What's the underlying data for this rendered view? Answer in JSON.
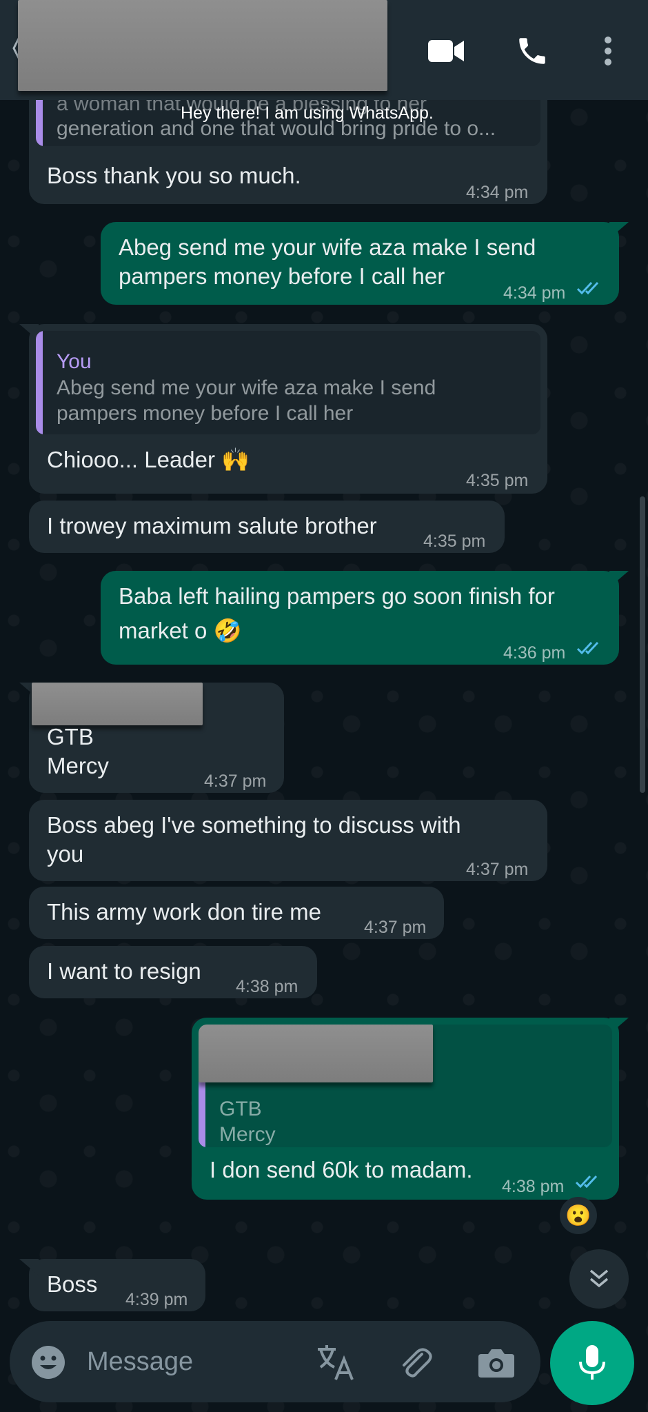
{
  "header": {
    "status": "Hey there! I am using WhatsApp.",
    "icons": [
      "video-call-icon",
      "voice-call-icon",
      "more-options-icon"
    ]
  },
  "messages": [
    {
      "dir": "in",
      "quote_text": [
        "a woman that would be a blessing to her",
        "generation and one that would bring pride to o..."
      ],
      "text": "Boss thank you so much.",
      "time": "4:34 pm"
    },
    {
      "dir": "out",
      "text": [
        "Abeg send me your wife aza make I send",
        "pampers money before I call her"
      ],
      "time": "4:34 pm",
      "status": "read"
    },
    {
      "dir": "in",
      "quote_name": "You",
      "quote_text": [
        "Abeg send me your wife aza make I send",
        "pampers money before I call her"
      ],
      "text": "Chiooo... Leader",
      "emoji": "🙌",
      "time": "4:35 pm"
    },
    {
      "dir": "in",
      "text": "I trowey maximum salute brother",
      "time": "4:35 pm"
    },
    {
      "dir": "out",
      "text": [
        "Baba left hailing pampers go soon finish for",
        "market o"
      ],
      "emoji": "🤣",
      "time": "4:36 pm",
      "status": "read"
    },
    {
      "dir": "in",
      "text": [
        "GTB",
        "Mercy"
      ],
      "time": "4:37 pm"
    },
    {
      "dir": "in",
      "text": [
        "Boss abeg I've something to discuss with",
        "you"
      ],
      "time": "4:37 pm"
    },
    {
      "dir": "in",
      "text": "This army work don tire me",
      "time": "4:37 pm"
    },
    {
      "dir": "in",
      "text": "I want to resign",
      "time": "4:38 pm"
    },
    {
      "dir": "out",
      "quote_text": [
        "GTB",
        "Mercy"
      ],
      "text": "I don send 60k to madam.",
      "time": "4:38 pm",
      "status": "read",
      "reaction": "😮"
    },
    {
      "dir": "in",
      "text": "Boss",
      "time": "4:39 pm"
    }
  ],
  "input": {
    "placeholder": "Message"
  },
  "colors": {
    "incoming": "#202c33",
    "outgoing": "#005c4b",
    "accent": "#00a884",
    "read_ticks": "#53bdeb",
    "quote_name": "#b79cf5"
  }
}
